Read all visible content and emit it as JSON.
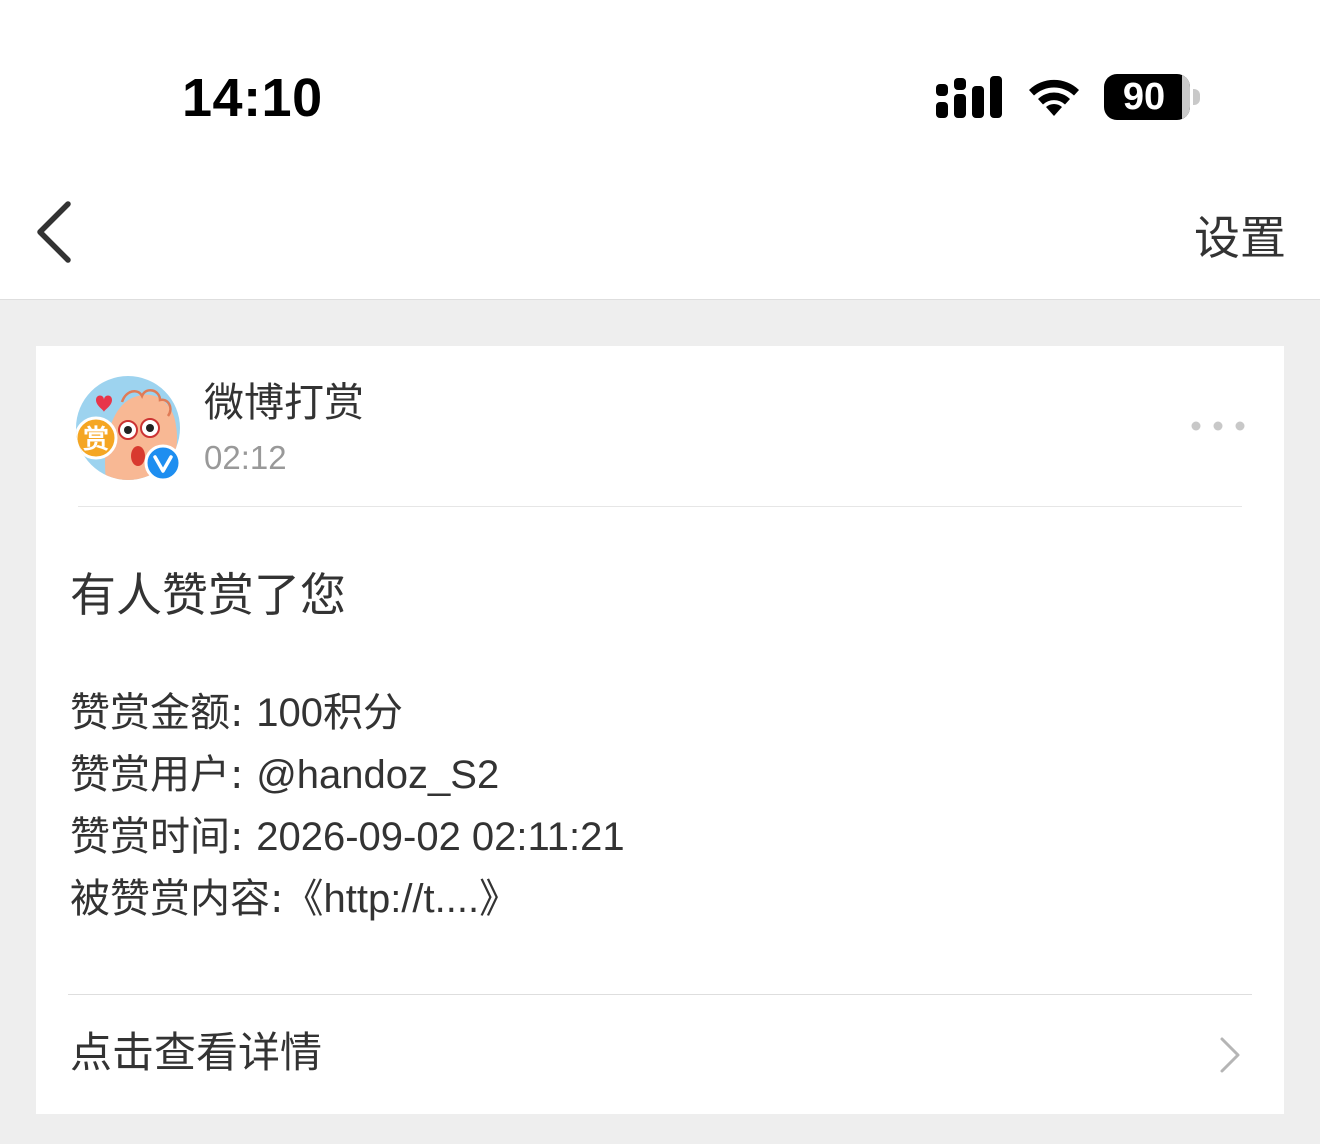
{
  "status_bar": {
    "time": "14:10",
    "battery_level": "90",
    "icons": [
      "cellular-signal-icon",
      "wifi-icon",
      "battery-icon"
    ]
  },
  "nav": {
    "back_icon": "chevron-left-icon",
    "settings_label": "设置"
  },
  "message": {
    "sender_name": "微博打赏",
    "sender_time": "02:12",
    "avatar_badge_text": "赏",
    "title": "有人赞赏了您",
    "details": [
      {
        "label": "赞赏金额: ",
        "value": "100积分"
      },
      {
        "label": "赞赏用户: ",
        "value": "@handoz_S2"
      },
      {
        "label": "赞赏时间: ",
        "value": "2026-09-02 02:11:21"
      },
      {
        "label": "被赞赏内容:",
        "value": "《http://t....》"
      }
    ],
    "view_details_label": "点击查看详情"
  },
  "colors": {
    "page_background": "#eeeeee",
    "card_background": "#ffffff",
    "primary_text": "#333333",
    "secondary_text": "#999999",
    "verified_blue": "#1e8ef0",
    "avatar_background": "#9dd3ef",
    "avatar_badge": "#f5a623"
  }
}
